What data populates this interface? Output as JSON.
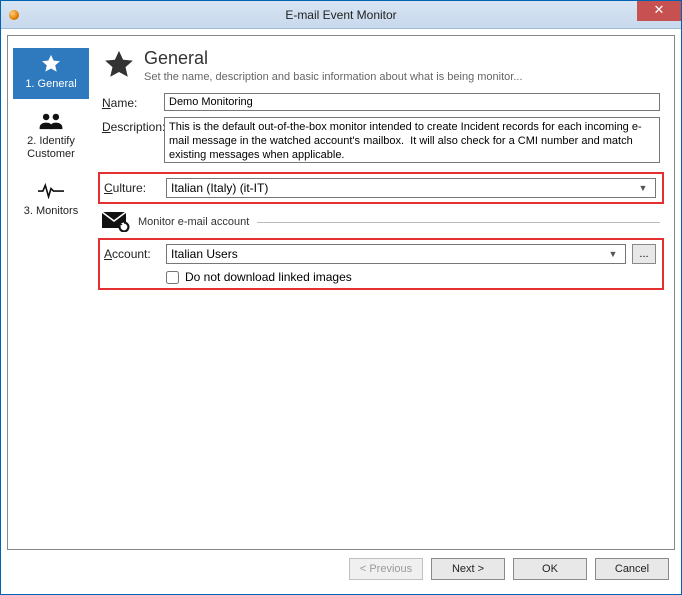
{
  "window": {
    "title": "E-mail Event Monitor"
  },
  "sidebar": {
    "steps": [
      {
        "label": "1. General"
      },
      {
        "label": "2. Identify Customer"
      },
      {
        "label": "3. Monitors"
      }
    ]
  },
  "header": {
    "title": "General",
    "subtitle": "Set the name, description and basic information about what is being monitor..."
  },
  "form": {
    "name_label": "Name:",
    "name_value": "Demo Monitoring",
    "description_label": "Description:",
    "description_value": "This is the default out-of-the-box monitor intended to create Incident records for each incoming e-mail message in the watched account's mailbox.  It will also check for a CMI number and match existing messages when applicable.",
    "culture_label": "Culture:",
    "culture_value": "Italian (Italy) (it-IT)",
    "section_label": "Monitor e-mail account",
    "account_label": "Account:",
    "account_value": "Italian Users",
    "browse_label": "...",
    "checkbox_label": "Do not download linked images"
  },
  "footer": {
    "previous": "< Previous",
    "next": "Next >",
    "ok": "OK",
    "cancel": "Cancel"
  }
}
